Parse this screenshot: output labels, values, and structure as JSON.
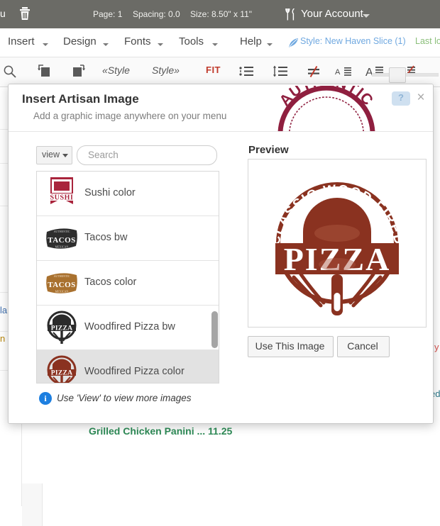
{
  "topbar": {
    "menu_label": "nu",
    "trash_icon": "trash-icon",
    "page": "Page: 1",
    "spacing": "Spacing: 0.0",
    "size": "Size: 8.50\" x 11\"",
    "account_icon": "fork-knife-icon",
    "account_label": "Your Account",
    "bg_color": "#6b6b66"
  },
  "menubar": {
    "items": [
      {
        "label": "Insert"
      },
      {
        "label": "Design"
      },
      {
        "label": "Fonts"
      },
      {
        "label": "Tools"
      },
      {
        "label": "Help"
      }
    ],
    "style_icon": "quill-icon",
    "style_label": "Style: New Haven Slice (1)",
    "style_color": "#6fa8e0",
    "lastlog_label": "Last log",
    "lastlog_color": "#8bbf7a"
  },
  "toolbar": {
    "icons": [
      "search-icon",
      "insert-image-left-icon",
      "insert-image-right-icon",
      "numbered-list-icon",
      "line-spacing-icon",
      "not-equal-icon",
      "align-small-icon",
      "align-medium-icon",
      "align-strike-icon"
    ],
    "style_prev_label": "«Style",
    "style_next_label": "Style»",
    "fit_label": "FIT",
    "fit_color": "#c0392b",
    "slider": "zoom-slider"
  },
  "background": {
    "fragment_left_1": "la",
    "fragment_left_2": "n",
    "fragment_right_1": "y",
    "fragment_right_2": "ed",
    "menu_item": "Grilled Chicken Panini ... 11.25",
    "menu_item_color": "#2e8b57"
  },
  "dialog": {
    "title": "Insert Artisan Image",
    "subtitle": "Add a graphic image anywhere on your menu",
    "stamp_text": "AUTHENTIC",
    "stamp_color": "#8f1f3f",
    "help_label": "?",
    "close_label": "×",
    "view_button_label": "view",
    "search_placeholder": "Search",
    "preview_label": "Preview",
    "items": [
      {
        "label": "Sushi color",
        "thumb": "sushi-banner-thumb",
        "selected": false
      },
      {
        "label": "Tacos bw",
        "thumb": "tacos-bw-thumb",
        "selected": false
      },
      {
        "label": "Tacos color",
        "thumb": "tacos-color-thumb",
        "selected": false
      },
      {
        "label": "Woodfired Pizza bw",
        "thumb": "pizza-bw-thumb",
        "selected": false
      },
      {
        "label": "Woodfired Pizza color",
        "thumb": "pizza-color-thumb",
        "selected": true
      }
    ],
    "preview": {
      "arc_text": "CLASSIC WOOD FIRED",
      "main_text": "PIZZA",
      "color": "#8a3220"
    },
    "use_button_label": "Use This Image",
    "cancel_button_label": "Cancel",
    "note_icon": "info-icon",
    "note_text": "Use 'View' to view more images"
  }
}
